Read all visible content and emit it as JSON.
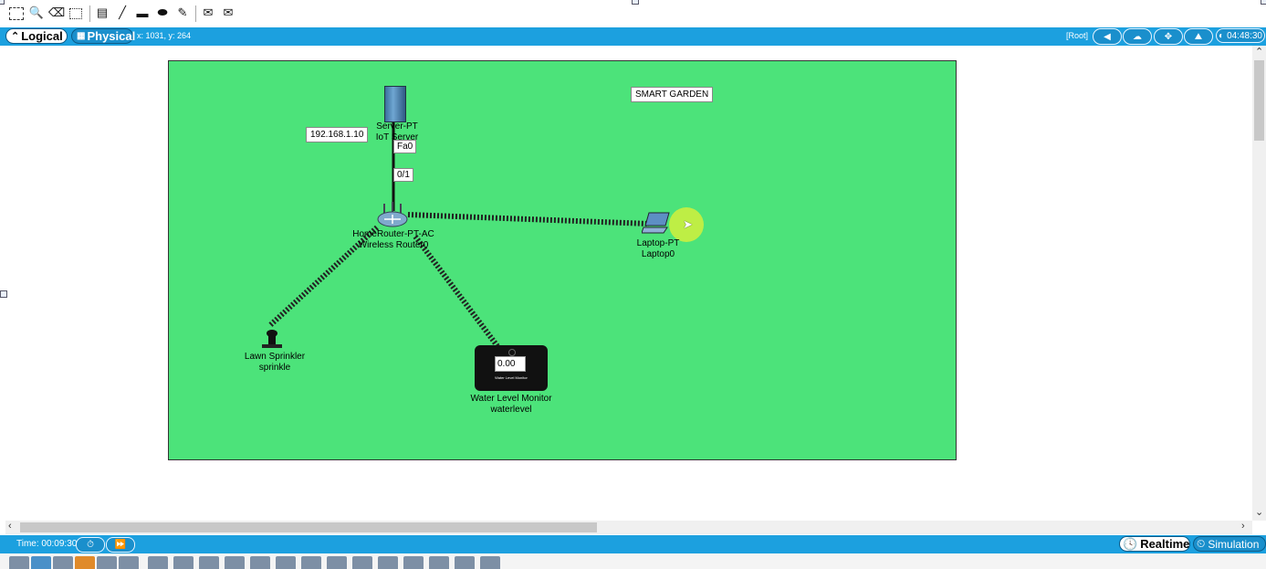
{
  "toolbar": {
    "icons": [
      "select-icon",
      "inspect-icon",
      "delete-icon",
      "resize-icon",
      "note-icon",
      "line-icon",
      "rectangle-icon",
      "ellipse-icon",
      "freeform-icon",
      "simple-pdu-icon",
      "complex-pdu-icon"
    ]
  },
  "modebar": {
    "logical_label": "Logical",
    "physical_label": "Physical",
    "coords": "x: 1031, y: 264",
    "root_label": "[Root]",
    "clock": "04:48:30"
  },
  "canvas": {
    "background": "#4ce37a",
    "title_note": "SMART GARDEN",
    "ip_note": "192.168.1.10",
    "port_fa0": "Fa0",
    "port_01": "0/1"
  },
  "devices": {
    "server": {
      "model": "Server-PT",
      "name": "IoT Server"
    },
    "router": {
      "model": "HomeRouter-PT-AC",
      "name": "Wireless Router0"
    },
    "laptop": {
      "model": "Laptop-PT",
      "name": "Laptop0"
    },
    "sprinkler": {
      "model": "Lawn Sprinkler",
      "name": "sprinkle"
    },
    "water": {
      "model": "Water Level Monitor",
      "name": "waterlevel",
      "reading": "0.00",
      "screen_caption": "Water Level Monitor"
    }
  },
  "bottombar": {
    "time": "Time: 00:09:30",
    "realtime_label": "Realtime",
    "simulation_label": "Simulation"
  },
  "colors": {
    "accent": "#1ca0df",
    "canvas": "#4ce37a"
  }
}
